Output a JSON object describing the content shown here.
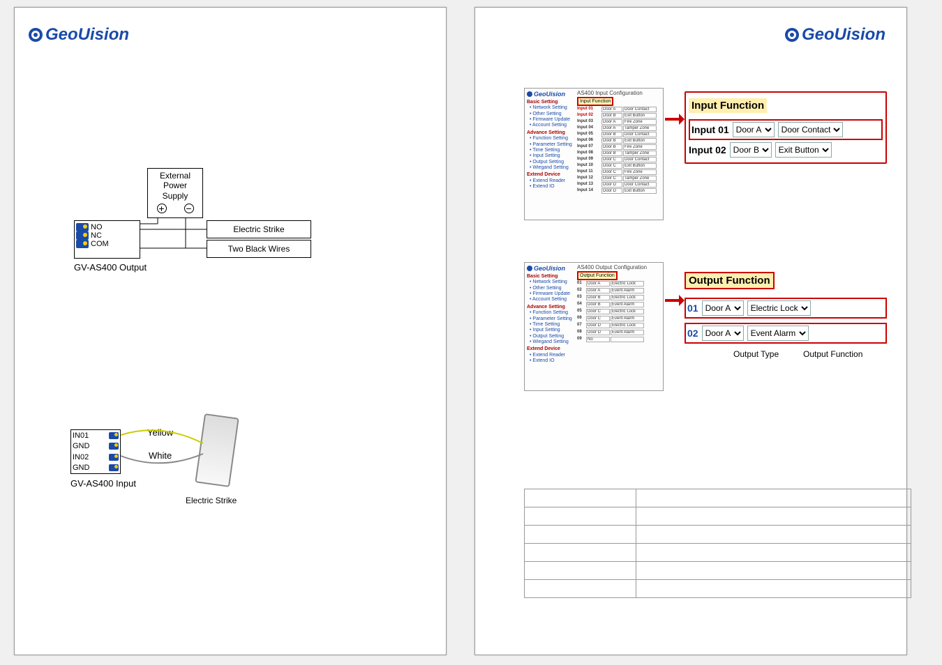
{
  "brand": "GeoUision",
  "left_page": {
    "diagram1": {
      "external_power": "External\nPower\nSupply",
      "plus": "+",
      "minus": "−",
      "out_labels": [
        "NO",
        "NC",
        "COM"
      ],
      "right_box1": "Electric Strike",
      "right_box2": "Two Black Wires",
      "caption": "GV-AS400 Output"
    },
    "diagram2": {
      "in_labels": [
        "IN01",
        "GND",
        "IN02",
        "GND"
      ],
      "yellow": "Yellow",
      "white": "White",
      "caption": "GV-AS400 Input",
      "strike_label": "Electric Strike"
    }
  },
  "right_page": {
    "input_fig": {
      "panel_title": "AS400 Input Configuration",
      "panel_header": "Input Function",
      "sidebar": {
        "brand": "GeoUision",
        "basic": "Basic Setting",
        "items1": [
          "Network Setting",
          "Other Setting",
          "Firmware Update",
          "Account Setting"
        ],
        "advance": "Advance Setting",
        "items2": [
          "Function Setting",
          "Parameter Setting",
          "Time Setting",
          "Input Setting",
          "Output Setting",
          "Wiegand Setting"
        ],
        "extend": "Extend Device",
        "items3": [
          "Extend Reader",
          "Extend IO"
        ]
      },
      "rows": [
        {
          "label": "Input 01",
          "door": "Door A",
          "func": "Door Contact"
        },
        {
          "label": "Input 02",
          "door": "Door B",
          "func": "Exit Button"
        },
        {
          "label": "Input 03",
          "door": "Door A",
          "func": "Fire Zone"
        },
        {
          "label": "Input 04",
          "door": "Door A",
          "func": "Tamper Zone"
        },
        {
          "label": "Input 05",
          "door": "Door B",
          "func": "Door Contact"
        },
        {
          "label": "Input 06",
          "door": "Door B",
          "func": "Exit Button"
        },
        {
          "label": "Input 07",
          "door": "Door B",
          "func": "Fire Zone"
        },
        {
          "label": "Input 08",
          "door": "Door B",
          "func": "Tamper Zone"
        },
        {
          "label": "Input 09",
          "door": "Door C",
          "func": "Door Contact"
        },
        {
          "label": "Input 10",
          "door": "Door C",
          "func": "Exit Button"
        },
        {
          "label": "Input 11",
          "door": "Door C",
          "func": "Fire Zone"
        },
        {
          "label": "Input 12",
          "door": "Door C",
          "func": "Tamper Zone"
        },
        {
          "label": "Input 13",
          "door": "Door D",
          "func": "Door Contact"
        },
        {
          "label": "Input 14",
          "door": "Door D",
          "func": "Exit Button"
        }
      ],
      "zoom": {
        "title": "Input Function",
        "rows": [
          {
            "label": "Input 01",
            "door": "Door A",
            "func": "Door Contact"
          },
          {
            "label": "Input 02",
            "door": "Door B",
            "func": "Exit Button"
          }
        ]
      }
    },
    "output_fig": {
      "panel_title": "AS400 Output Configuration",
      "panel_header": "Output Function",
      "sidebar": {
        "brand": "GeoUision",
        "basic": "Basic Setting",
        "items1": [
          "Network Setting",
          "Other Setting",
          "Firmware Update",
          "Account Setting"
        ],
        "advance": "Advance Setting",
        "items2": [
          "Function Setting",
          "Parameter Setting",
          "Time Setting",
          "Input Setting",
          "Output Setting",
          "Wiegand Setting"
        ],
        "extend": "Extend Device",
        "items3": [
          "Extend Reader",
          "Extend IO"
        ]
      },
      "rows": [
        {
          "num": "01",
          "door": "Door A",
          "func": "Electric Lock"
        },
        {
          "num": "02",
          "door": "Door A",
          "func": "Event Alarm"
        },
        {
          "num": "03",
          "door": "Door B",
          "func": "Electric Lock"
        },
        {
          "num": "04",
          "door": "Door B",
          "func": "Event Alarm"
        },
        {
          "num": "05",
          "door": "Door C",
          "func": "Electric Lock"
        },
        {
          "num": "06",
          "door": "Door C",
          "func": "Event Alarm"
        },
        {
          "num": "07",
          "door": "Door D",
          "func": "Electric Lock"
        },
        {
          "num": "08",
          "door": "Door D",
          "func": "Event Alarm"
        },
        {
          "num": "09",
          "door": "No Function",
          "func": ""
        }
      ],
      "zoom": {
        "title": "Output Function",
        "rows": [
          {
            "num": "01",
            "door": "Door A",
            "func": "Electric Lock"
          },
          {
            "num": "02",
            "door": "Door A",
            "func": "Event Alarm"
          }
        ],
        "below_labels": [
          "Output Type",
          "Output Function"
        ]
      }
    }
  }
}
